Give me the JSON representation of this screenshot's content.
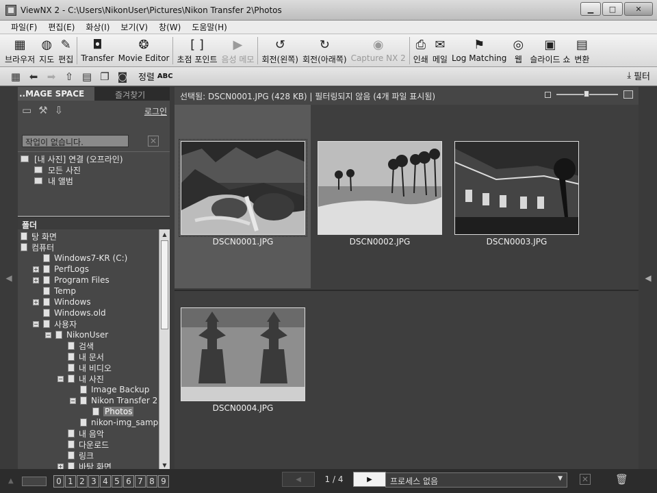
{
  "window": {
    "title": "ViewNX 2 - C:\\Users\\NikonUser\\Pictures\\Nikon Transfer 2\\Photos",
    "min": "▁",
    "max": "□",
    "close": "✕"
  },
  "menu": [
    "파일(F)",
    "편집(E)",
    "화상(I)",
    "보기(V)",
    "창(W)",
    "도움말(H)"
  ],
  "toolbar": [
    {
      "label": "브라우저",
      "icon": "browser-icon",
      "glyph": "▦"
    },
    {
      "label": "지도",
      "icon": "globe-icon",
      "glyph": "◍"
    },
    {
      "label": "편집",
      "icon": "edit-icon",
      "glyph": "✎"
    },
    {
      "label": "Transfer",
      "icon": "camera-icon",
      "glyph": "◘"
    },
    {
      "label": "Movie Editor",
      "icon": "film-reel-icon",
      "glyph": "❂"
    },
    {
      "label": "초점 포인트",
      "icon": "focus-bracket-icon",
      "glyph": "[ ]"
    },
    {
      "label": "음성 메모",
      "icon": "voice-memo-icon",
      "glyph": "▶",
      "disabled": true
    },
    {
      "label": "회전(왼쪽)",
      "icon": "rotate-left-icon",
      "glyph": "↺"
    },
    {
      "label": "회전(아래쪽)",
      "icon": "rotate-right-icon",
      "glyph": "↻"
    },
    {
      "label": "Capture NX 2",
      "icon": "capture-nx-icon",
      "glyph": "◉",
      "disabled": true
    },
    {
      "label": "인쇄",
      "icon": "printer-icon",
      "glyph": "⎙"
    },
    {
      "label": "메일",
      "icon": "mail-icon",
      "glyph": "✉"
    },
    {
      "label": "Log Matching",
      "icon": "log-matching-icon",
      "glyph": "⚑"
    },
    {
      "label": "웹",
      "icon": "web-icon",
      "glyph": "◎"
    },
    {
      "label": "슬라이드 쇼",
      "icon": "slideshow-icon",
      "glyph": "▣"
    },
    {
      "label": "변환",
      "icon": "convert-icon",
      "glyph": "▤"
    }
  ],
  "subbar": {
    "sort_label": "정렬",
    "sort_value": "ABC",
    "filter_label": "필터"
  },
  "left_panel": {
    "tab_active": "..MAGE SPACE",
    "tab_other": "즐겨찾기",
    "login": "로그인",
    "status": "작업이 없습니다.",
    "ims_tree": [
      "[내 사진] 연결 (오프라인)",
      "모든 사진",
      "내 앨범"
    ],
    "folder_header": "폴더",
    "tree": [
      {
        "label": "탕 화면",
        "indent": 0,
        "exp": ""
      },
      {
        "label": "컴퓨터",
        "indent": 0,
        "exp": ""
      },
      {
        "label": "Windows7-KR (C:)",
        "indent": 1,
        "exp": ""
      },
      {
        "label": "PerfLogs",
        "indent": 1,
        "exp": "+"
      },
      {
        "label": "Program Files",
        "indent": 1,
        "exp": "+"
      },
      {
        "label": "Temp",
        "indent": 1,
        "exp": ""
      },
      {
        "label": "Windows",
        "indent": 1,
        "exp": "+"
      },
      {
        "label": "Windows.old",
        "indent": 1,
        "exp": ""
      },
      {
        "label": "사용자",
        "indent": 1,
        "exp": "−"
      },
      {
        "label": "NikonUser",
        "indent": 2,
        "exp": "−"
      },
      {
        "label": "검색",
        "indent": 3,
        "exp": ""
      },
      {
        "label": "내 문서",
        "indent": 3,
        "exp": ""
      },
      {
        "label": "내 비디오",
        "indent": 3,
        "exp": ""
      },
      {
        "label": "내 사진",
        "indent": 3,
        "exp": "−"
      },
      {
        "label": "Image Backup",
        "indent": 4,
        "exp": ""
      },
      {
        "label": "Nikon Transfer 2",
        "indent": 4,
        "exp": "−"
      },
      {
        "label": "Photos",
        "indent": 5,
        "exp": "",
        "selected": true
      },
      {
        "label": "nikon-img_sample",
        "indent": 4,
        "exp": ""
      },
      {
        "label": "내 음악",
        "indent": 3,
        "exp": ""
      },
      {
        "label": "다운로드",
        "indent": 3,
        "exp": ""
      },
      {
        "label": "링크",
        "indent": 3,
        "exp": ""
      },
      {
        "label": "바탕 화면",
        "indent": 3,
        "exp": "+"
      }
    ]
  },
  "main": {
    "status": "선택됨: DSCN0001.JPG (428 KB) | 필터링되지 않음 (4개 파일 표시됨)",
    "thumbnails": [
      {
        "name": "DSCN0001.JPG",
        "scene": "waterfall",
        "selected": true
      },
      {
        "name": "DSCN0002.JPG",
        "scene": "beach"
      },
      {
        "name": "DSCN0003.JPG",
        "scene": "building"
      },
      {
        "name": "DSCN0004.JPG",
        "scene": "statues"
      }
    ]
  },
  "bottom": {
    "ratings": [
      "0",
      "1",
      "2",
      "3",
      "4",
      "5",
      "6",
      "7",
      "8",
      "9"
    ],
    "page": "1 / 4",
    "process": "프로세스 없음"
  }
}
